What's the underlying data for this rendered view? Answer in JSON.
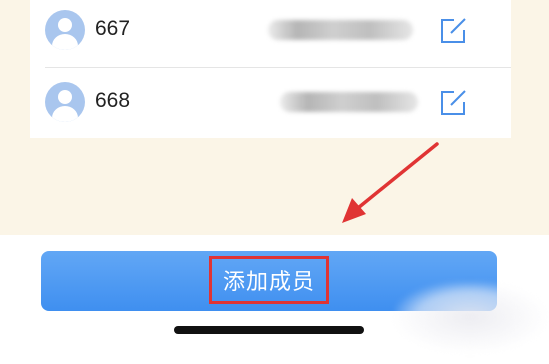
{
  "members": [
    {
      "name": "667",
      "phone": "••••••••••"
    },
    {
      "name": "668",
      "phone": "••••••••••"
    }
  ],
  "actions": {
    "add_member_label": "添加成员"
  },
  "icons": {
    "avatar": "user-avatar-icon",
    "edit": "edit-icon",
    "arrow": "red-arrow-annotation"
  },
  "colors": {
    "page_bg": "#fbf5e7",
    "button_blue": "#4a97f2",
    "edit_blue": "#4a8fe8",
    "annotation_red": "#e03434",
    "avatar_blue": "#a9c6ee"
  }
}
